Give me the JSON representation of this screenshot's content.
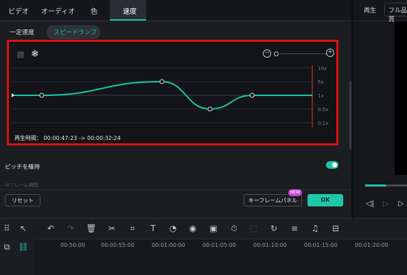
{
  "tabs": [
    "ビデオ",
    "オーディオ",
    "色",
    "速度"
  ],
  "speed_modes": [
    "一定速度",
    "スピードランプ"
  ],
  "curve": {
    "y_labels": [
      "10x",
      "5x",
      "1x",
      "0.5x",
      "0.1x"
    ],
    "duration_label": "再生時間：",
    "duration_value": "00:00:47:23 -> 00:00:32:24",
    "line_color": "#1fc7a9",
    "points": [
      {
        "t": 0.0,
        "speed": "1x"
      },
      {
        "t": 0.1,
        "speed": "1x"
      },
      {
        "t": 0.5,
        "speed": "5x"
      },
      {
        "t": 0.66,
        "speed": "0.5x"
      },
      {
        "t": 0.8,
        "speed": "1x"
      },
      {
        "t": 1.0,
        "speed": "1x"
      }
    ]
  },
  "pitch": {
    "label": "ピッチを維持",
    "enabled": true
  },
  "faded_label": "AIフレーム補間",
  "buttons": {
    "reset": "リセット",
    "keyframe": "キーフレームパネル",
    "new_badge": "NEW",
    "ok": "OK"
  },
  "preview": {
    "tab_play": "再生",
    "tab_quality": "フル品質"
  },
  "timeline": {
    "timecodes": [
      "00:50:00",
      "00:00:55:00",
      "00:01:00:00",
      "00:01:05:00",
      "00:01:10:00",
      "00:01:15:00",
      "00:01:20:00"
    ]
  },
  "toolbar_icons": [
    "grid-icon",
    "select-arrow-icon",
    "undo-icon",
    "redo-icon",
    "delete-icon",
    "cut-icon",
    "crop-icon",
    "text-icon",
    "speed-icon",
    "color-icon",
    "mask-icon",
    "timer-icon",
    "freeze-icon",
    "motion-icon",
    "adjust-icon",
    "audio-icon",
    "split-icon"
  ],
  "colors": {
    "accent": "#1fc7a9",
    "highlight_border": "#e10f0f",
    "badge": "#c94bd9"
  }
}
